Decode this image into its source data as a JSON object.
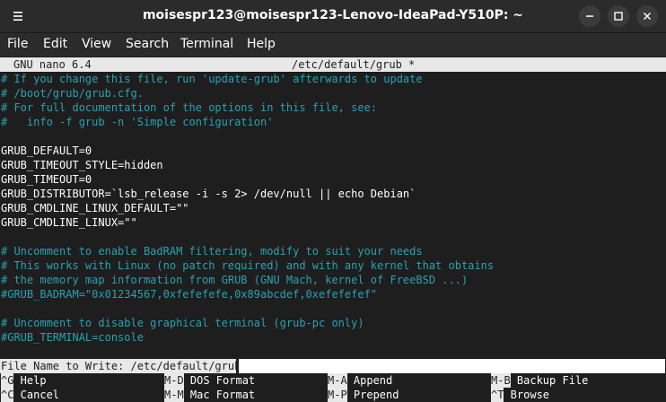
{
  "window": {
    "title": "moisespr123@moisespr123-Lenovo-IdeaPad-Y510P: ~"
  },
  "menu": [
    "File",
    "Edit",
    "View",
    "Search",
    "Terminal",
    "Help"
  ],
  "nano": {
    "version": "GNU nano 6.4",
    "filename": "/etc/default/grub *"
  },
  "lines": [
    {
      "text": "# If you change this file, run 'update-grub' afterwards to update",
      "type": "comment"
    },
    {
      "text": "# /boot/grub/grub.cfg.",
      "type": "comment"
    },
    {
      "text": "# For full documentation of the options in this file, see:",
      "type": "comment"
    },
    {
      "text": "#   info -f grub -n 'Simple configuration'",
      "type": "comment"
    },
    {
      "text": "",
      "type": "normal"
    },
    {
      "text": "GRUB_DEFAULT=0",
      "type": "normal"
    },
    {
      "text": "GRUB_TIMEOUT_STYLE=hidden",
      "type": "normal"
    },
    {
      "text": "GRUB_TIMEOUT=0",
      "type": "normal"
    },
    {
      "text": "GRUB_DISTRIBUTOR=`lsb_release -i -s 2> /dev/null || echo Debian`",
      "type": "normal"
    },
    {
      "text": "GRUB_CMDLINE_LINUX_DEFAULT=\"\"",
      "type": "normal"
    },
    {
      "text": "GRUB_CMDLINE_LINUX=\"\"",
      "type": "normal"
    },
    {
      "text": "",
      "type": "normal"
    },
    {
      "text": "# Uncomment to enable BadRAM filtering, modify to suit your needs",
      "type": "comment"
    },
    {
      "text": "# This works with Linux (no patch required) and with any kernel that obtains",
      "type": "comment"
    },
    {
      "text": "# the memory map information from GRUB (GNU Mach, kernel of FreeBSD ...)",
      "type": "comment"
    },
    {
      "text": "#GRUB_BADRAM=\"0x01234567,0xfefefefe,0x89abcdef,0xefefefef\"",
      "type": "comment"
    },
    {
      "text": "",
      "type": "normal"
    },
    {
      "text": "# Uncomment to disable graphical terminal (grub-pc only)",
      "type": "comment"
    },
    {
      "text": "#GRUB_TERMINAL=console",
      "type": "comment"
    }
  ],
  "prompt": {
    "label": "File Name to Write: /etc/default/grub"
  },
  "shortcuts": {
    "row1": [
      {
        "key": "^G",
        "label": "Help"
      },
      {
        "key": "M-D",
        "label": "DOS Format"
      },
      {
        "key": "M-A",
        "label": "Append"
      },
      {
        "key": "M-B",
        "label": "Backup File"
      }
    ],
    "row2": [
      {
        "key": "^C",
        "label": "Cancel"
      },
      {
        "key": "M-M",
        "label": "Mac Format"
      },
      {
        "key": "M-P",
        "label": "Prepend"
      },
      {
        "key": "^T",
        "label": "Browse"
      }
    ]
  },
  "colors": {
    "comment": "#2aa1b3",
    "background": "#1e1e1e",
    "bar": "#e8e8e8"
  },
  "icons": [
    "menu-icon",
    "minimize-icon",
    "maximize-icon",
    "close-icon"
  ]
}
